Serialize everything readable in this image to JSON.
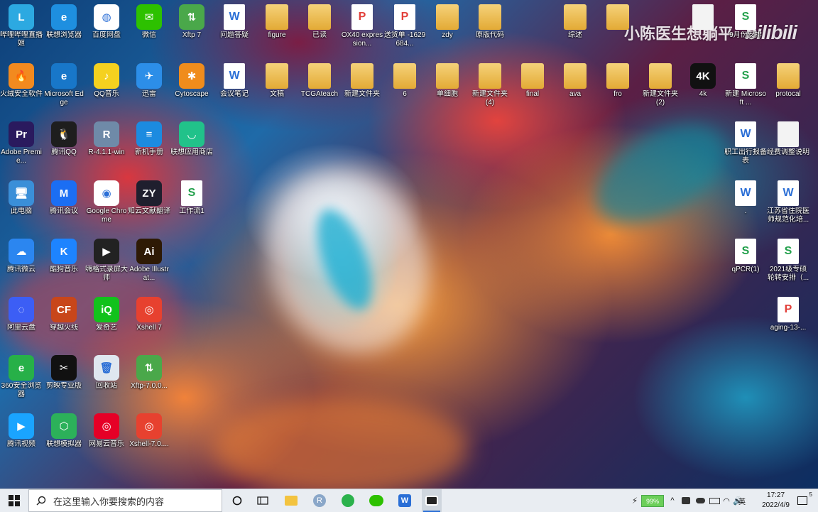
{
  "watermark": {
    "text": "小陈医生想躺平",
    "brand": "bilibili"
  },
  "desktop_icons": [
    {
      "label": "哔哩哔哩直播姬",
      "kind": "app",
      "color": "#2ca9e1",
      "glyph": "L",
      "col": 0,
      "row": 0
    },
    {
      "label": "联想浏览器",
      "kind": "app",
      "color": "#1e8fe0",
      "glyph": "e",
      "col": 1,
      "row": 0
    },
    {
      "label": "百度网盘",
      "kind": "app",
      "color": "#ffffff",
      "glyph": "◍",
      "col": 2,
      "row": 0
    },
    {
      "label": "微信",
      "kind": "app",
      "color": "#2dc100",
      "glyph": "✉",
      "col": 3,
      "row": 0
    },
    {
      "label": "Xftp 7",
      "kind": "app",
      "color": "#4aa84a",
      "glyph": "⇅",
      "col": 4,
      "row": 0
    },
    {
      "label": "问题答疑",
      "kind": "doc",
      "color": "#2b6fd6",
      "glyph": "W",
      "col": 5,
      "row": 0
    },
    {
      "label": "figure",
      "kind": "folder",
      "color": "#e3aa35",
      "glyph": "",
      "col": 6,
      "row": 0
    },
    {
      "label": "已读",
      "kind": "folder",
      "color": "#e3aa35",
      "glyph": "",
      "col": 7,
      "row": 0
    },
    {
      "label": "OX40 expression...",
      "kind": "pdf",
      "color": "#e2403a",
      "glyph": "P",
      "col": 8,
      "row": 0
    },
    {
      "label": "送货单 -1629684...",
      "kind": "pdf",
      "color": "#e2403a",
      "glyph": "P",
      "col": 9,
      "row": 0
    },
    {
      "label": "zdy",
      "kind": "folder",
      "color": "#e3aa35",
      "glyph": "",
      "col": 10,
      "row": 0
    },
    {
      "label": "原版代码",
      "kind": "folder",
      "color": "#e3aa35",
      "glyph": "",
      "col": 11,
      "row": 0
    },
    {
      "label": "综述",
      "kind": "folder",
      "color": "#e3aa35",
      "glyph": "",
      "col": 13,
      "row": 0
    },
    {
      "label": "",
      "kind": "folder",
      "color": "#e3aa35",
      "glyph": "",
      "col": 14,
      "row": 0
    },
    {
      "label": "",
      "kind": "plain",
      "color": "#f3f3f3",
      "glyph": "",
      "col": 16,
      "row": 0
    },
    {
      "label": "9月份安排",
      "kind": "xls",
      "color": "#22a04b",
      "glyph": "S",
      "col": 17,
      "row": 0
    },
    {
      "label": "火绒安全软件",
      "kind": "app",
      "color": "#f28a1f",
      "glyph": "🔥",
      "col": 0,
      "row": 1
    },
    {
      "label": "Microsoft Edge",
      "kind": "app",
      "color": "#1877c9",
      "glyph": "e",
      "col": 1,
      "row": 1
    },
    {
      "label": "QQ音乐",
      "kind": "app",
      "color": "#f5d11f",
      "glyph": "♪",
      "col": 2,
      "row": 1
    },
    {
      "label": "迅雷",
      "kind": "app",
      "color": "#2c8ee8",
      "glyph": "✈",
      "col": 3,
      "row": 1
    },
    {
      "label": "Cytoscape",
      "kind": "app",
      "color": "#f08c1c",
      "glyph": "✱",
      "col": 4,
      "row": 1
    },
    {
      "label": "会议笔记",
      "kind": "doc",
      "color": "#2b6fd6",
      "glyph": "W",
      "col": 5,
      "row": 1
    },
    {
      "label": "文稿",
      "kind": "folder",
      "color": "#e3aa35",
      "glyph": "",
      "col": 6,
      "row": 1
    },
    {
      "label": "TCGAteach",
      "kind": "folder",
      "color": "#e3aa35",
      "glyph": "",
      "col": 7,
      "row": 1
    },
    {
      "label": "新建文件夹",
      "kind": "folder",
      "color": "#e3aa35",
      "glyph": "",
      "col": 8,
      "row": 1
    },
    {
      "label": "6",
      "kind": "folder",
      "color": "#e3aa35",
      "glyph": "",
      "col": 9,
      "row": 1
    },
    {
      "label": "单细胞",
      "kind": "folder",
      "color": "#e3aa35",
      "glyph": "",
      "col": 10,
      "row": 1
    },
    {
      "label": "新建文件夹 (4)",
      "kind": "folder",
      "color": "#e3aa35",
      "glyph": "",
      "col": 11,
      "row": 1
    },
    {
      "label": "final",
      "kind": "folder",
      "color": "#e3aa35",
      "glyph": "",
      "col": 12,
      "row": 1
    },
    {
      "label": "ava",
      "kind": "folder",
      "color": "#e3aa35",
      "glyph": "",
      "col": 13,
      "row": 1
    },
    {
      "label": "fro",
      "kind": "folder",
      "color": "#e3aa35",
      "glyph": "",
      "col": 14,
      "row": 1
    },
    {
      "label": "新建文件夹 (2)",
      "kind": "folder",
      "color": "#e3aa35",
      "glyph": "",
      "col": 15,
      "row": 1
    },
    {
      "label": "4k",
      "kind": "app",
      "color": "#111111",
      "glyph": "4K",
      "col": 16,
      "row": 1
    },
    {
      "label": "新建 Microsoft ...",
      "kind": "xls",
      "color": "#22a04b",
      "glyph": "S",
      "col": 17,
      "row": 1
    },
    {
      "label": "protocal",
      "kind": "folder",
      "color": "#e3aa35",
      "glyph": "",
      "col": 18,
      "row": 1
    },
    {
      "label": "Adobe Premie...",
      "kind": "app",
      "color": "#2a1a5e",
      "glyph": "Pr",
      "col": 0,
      "row": 2
    },
    {
      "label": "腾讯QQ",
      "kind": "app",
      "color": "#1e1e1e",
      "glyph": "🐧",
      "col": 1,
      "row": 2
    },
    {
      "label": "R-4.1.1-win",
      "kind": "app",
      "color": "#6f8aa8",
      "glyph": "R",
      "col": 2,
      "row": 2
    },
    {
      "label": "新机手册",
      "kind": "app",
      "color": "#1c8be0",
      "glyph": "≡",
      "col": 3,
      "row": 2
    },
    {
      "label": "联想应用商店",
      "kind": "app",
      "color": "#21c28a",
      "glyph": "◡",
      "col": 4,
      "row": 2
    },
    {
      "label": "职工出行报备表",
      "kind": "doc",
      "color": "#2b6fd6",
      "glyph": "W",
      "col": 17,
      "row": 2
    },
    {
      "label": "经费调整说明",
      "kind": "plain",
      "color": "#f3f3f3",
      "glyph": "",
      "col": 18,
      "row": 2
    },
    {
      "label": "此电脑",
      "kind": "app",
      "color": "#3a8fd8",
      "glyph": "🖥",
      "col": 0,
      "row": 3
    },
    {
      "label": "腾讯会议",
      "kind": "app",
      "color": "#1b6ef3",
      "glyph": "M",
      "col": 1,
      "row": 3
    },
    {
      "label": "Google Chrome",
      "kind": "app",
      "color": "#ffffff",
      "glyph": "◉",
      "col": 2,
      "row": 3
    },
    {
      "label": "知云文献翻译",
      "kind": "app",
      "color": "#1f1f2e",
      "glyph": "ZY",
      "col": 3,
      "row": 3
    },
    {
      "label": "工作流1",
      "kind": "xls",
      "color": "#22a04b",
      "glyph": "S",
      "col": 4,
      "row": 3
    },
    {
      "label": ".",
      "kind": "doc",
      "color": "#2b6fd6",
      "glyph": "W",
      "col": 17,
      "row": 3
    },
    {
      "label": "江苏省住院医师规范化培...",
      "kind": "doc",
      "color": "#2b6fd6",
      "glyph": "W",
      "col": 18,
      "row": 3
    },
    {
      "label": "腾讯微云",
      "kind": "app",
      "color": "#2b86f0",
      "glyph": "☁",
      "col": 0,
      "row": 4
    },
    {
      "label": "酷狗音乐",
      "kind": "app",
      "color": "#1d84ff",
      "glyph": "K",
      "col": 1,
      "row": 4
    },
    {
      "label": "嗨格式录屏大师",
      "kind": "app",
      "color": "#222222",
      "glyph": "▶",
      "col": 2,
      "row": 4
    },
    {
      "label": "Adobe Illustrat...",
      "kind": "app",
      "color": "#2e1a05",
      "glyph": "Ai",
      "col": 3,
      "row": 4
    },
    {
      "label": "qPCR(1)",
      "kind": "xls",
      "color": "#22a04b",
      "glyph": "S",
      "col": 17,
      "row": 4
    },
    {
      "label": "2021级专硕轮转安排（...",
      "kind": "xls",
      "color": "#22a04b",
      "glyph": "S",
      "col": 18,
      "row": 4
    },
    {
      "label": "阿里云盘",
      "kind": "app",
      "color": "#3c5ef5",
      "glyph": "◌",
      "col": 0,
      "row": 5
    },
    {
      "label": "穿越火线",
      "kind": "app",
      "color": "#c8461a",
      "glyph": "CF",
      "col": 1,
      "row": 5
    },
    {
      "label": "爱奇艺",
      "kind": "app",
      "color": "#12c21c",
      "glyph": "iQ",
      "col": 2,
      "row": 5
    },
    {
      "label": "Xshell 7",
      "kind": "app",
      "color": "#e7412f",
      "glyph": "◎",
      "col": 3,
      "row": 5
    },
    {
      "label": "aging-13-...",
      "kind": "pdf",
      "color": "#e2403a",
      "glyph": "P",
      "col": 18,
      "row": 5
    },
    {
      "label": "360安全浏览器",
      "kind": "app",
      "color": "#27b048",
      "glyph": "e",
      "col": 0,
      "row": 6
    },
    {
      "label": "剪映专业版",
      "kind": "app",
      "color": "#111111",
      "glyph": "✂",
      "col": 1,
      "row": 6
    },
    {
      "label": "回收站",
      "kind": "app",
      "color": "#dfe7ef",
      "glyph": "🗑",
      "col": 2,
      "row": 6
    },
    {
      "label": "Xftp-7.0.0...",
      "kind": "app",
      "color": "#4aa84a",
      "glyph": "⇅",
      "col": 3,
      "row": 6
    },
    {
      "label": "腾讯视频",
      "kind": "app",
      "color": "#1aa4ff",
      "glyph": "▶",
      "col": 0,
      "row": 7
    },
    {
      "label": "联想模拟器",
      "kind": "app",
      "color": "#2cb15a",
      "glyph": "⬡",
      "col": 1,
      "row": 7
    },
    {
      "label": "网易云音乐",
      "kind": "app",
      "color": "#e60026",
      "glyph": "◎",
      "col": 2,
      "row": 7
    },
    {
      "label": "Xshell-7.0....",
      "kind": "app",
      "color": "#e7412f",
      "glyph": "◎",
      "col": 3,
      "row": 7
    }
  ],
  "taskbar": {
    "search_placeholder": "在这里输入你要搜索的内容",
    "battery": "99%",
    "ime": "英",
    "time": "17:27",
    "date": "2022/4/9",
    "notification_count": "5"
  }
}
